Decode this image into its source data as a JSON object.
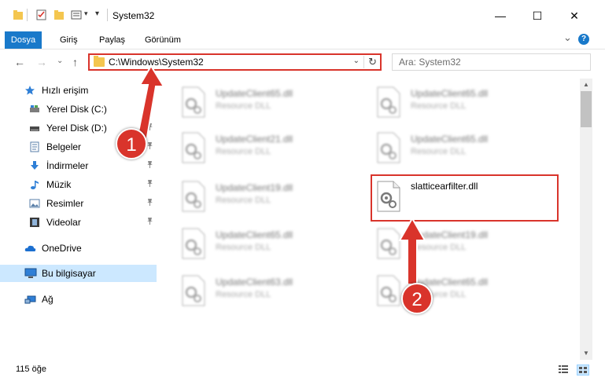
{
  "window": {
    "title": "System32",
    "minimize": "—",
    "maximize": "☐",
    "close": "✕"
  },
  "ribbon": {
    "tabs": [
      {
        "label": "Dosya"
      },
      {
        "label": "Giriş"
      },
      {
        "label": "Paylaş"
      },
      {
        "label": "Görünüm"
      }
    ],
    "expand_symbol": "⌄",
    "help_symbol": "?"
  },
  "nav": {
    "back": "←",
    "forward": "→",
    "recent": "⌄",
    "up": "↑",
    "address": "C:\\Windows\\System32",
    "address_dropdown": "⌄",
    "refresh": "↻",
    "search_placeholder": "Ara: System32"
  },
  "sidebar": {
    "quick_access": "Hızlı erişim",
    "items": [
      {
        "label": "Yerel Disk (C:)"
      },
      {
        "label": "Yerel Disk (D:)"
      },
      {
        "label": "Belgeler"
      },
      {
        "label": "İndirmeler"
      },
      {
        "label": "Müzik"
      },
      {
        "label": "Resimler"
      },
      {
        "label": "Videolar"
      }
    ],
    "onedrive": "OneDrive",
    "this_pc": "Bu bilgisayar",
    "network": "Ağ",
    "pin_symbol": "📌"
  },
  "files": [
    {
      "name": "UpdateClient65.dll",
      "desc": "Resource DLL"
    },
    {
      "name": "UpdateClient65.dll",
      "desc": "Resource DLL"
    },
    {
      "name": "UpdateClient21.dll",
      "desc": "Resource DLL"
    },
    {
      "name": "UpdateClient65.dll",
      "desc": "Resource DLL"
    },
    {
      "name": "UpdateClient19.dll",
      "desc": "Resource DLL"
    },
    {
      "name": "slatticearfilter.dll",
      "desc": ""
    },
    {
      "name": "UpdateClient65.dll",
      "desc": "Resource DLL"
    },
    {
      "name": "UpdateClient19.dll",
      "desc": "Resource DLL"
    },
    {
      "name": "UpdateClient63.dll",
      "desc": "Resource DLL"
    },
    {
      "name": "UpdateClient65.dll",
      "desc": "Resource DLL"
    }
  ],
  "status": {
    "item_count": "115 öğe"
  },
  "callouts": {
    "one": "1",
    "two": "2"
  },
  "colors": {
    "accent": "#1979ca",
    "highlight": "#d9342b",
    "selection": "#cce8ff"
  }
}
